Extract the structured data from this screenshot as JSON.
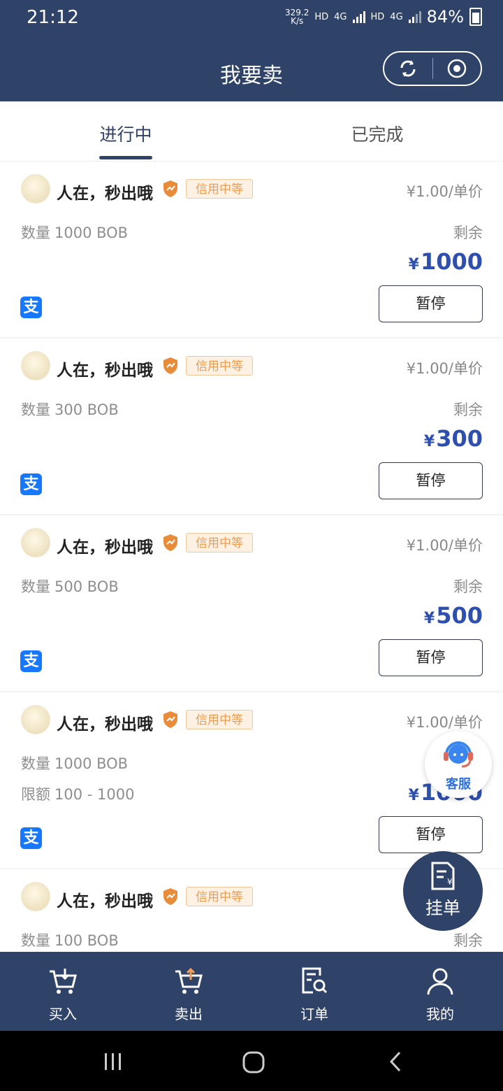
{
  "status_bar": {
    "time": "21:12",
    "net_speed_top": "329.2",
    "net_speed_bottom": "K/s",
    "hd1": "HD",
    "sig1": "4G",
    "hd2": "HD",
    "sig2": "4G",
    "battery": "84%"
  },
  "header": {
    "title": "我要卖",
    "refresh_icon": "refresh-icon",
    "record_icon": "record-icon"
  },
  "tabs": [
    {
      "label": "进行中",
      "active": true
    },
    {
      "label": "已完成",
      "active": false
    }
  ],
  "labels": {
    "qty": "数量",
    "unit_price_suffix": "/单价",
    "remain": "剩余",
    "limit": "限额",
    "pause": "暂停",
    "alipay_glyph": "支"
  },
  "listings": [
    {
      "user": "人在，秒出哦",
      "credit": "信用中等",
      "price": "¥1.00/单价",
      "qty": "1000  BOB",
      "remain_label": "剩余",
      "remain_currency": "¥",
      "remain": "1000",
      "pause": "暂停"
    },
    {
      "user": "人在，秒出哦",
      "credit": "信用中等",
      "price": "¥1.00/单价",
      "qty": "300  BOB",
      "remain_label": "剩余",
      "remain_currency": "¥",
      "remain": "300",
      "pause": "暂停"
    },
    {
      "user": "人在，秒出哦",
      "credit": "信用中等",
      "price": "¥1.00/单价",
      "qty": "500  BOB",
      "remain_label": "剩余",
      "remain_currency": "¥",
      "remain": "500",
      "pause": "暂停"
    },
    {
      "user": "人在，秒出哦",
      "credit": "信用中等",
      "price": "¥1.00/单价",
      "qty": "1000  BOB",
      "limit_label": "限额",
      "limit": "100 - 1000",
      "remain_label": "",
      "remain_currency": "¥",
      "remain": "1000",
      "pause": "暂停"
    },
    {
      "user": "人在，秒出哦",
      "credit": "信用中等",
      "price": "",
      "qty": "100  BOB",
      "remain_label": "剩余",
      "remain_currency": "",
      "remain": "",
      "pause": ""
    }
  ],
  "floating": {
    "customer_service": "客服",
    "post_order": "挂单"
  },
  "bottom_nav": [
    {
      "label": "买入",
      "icon": "cart-download-icon"
    },
    {
      "label": "卖出",
      "icon": "cart-upload-icon",
      "active": true
    },
    {
      "label": "订单",
      "icon": "order-search-icon"
    },
    {
      "label": "我的",
      "icon": "user-icon"
    }
  ],
  "colors": {
    "primary": "#2f4268",
    "accent_blue": "#2e4fad",
    "credit_orange": "#f19b4c",
    "active_tab_orange": "#f5a05a"
  }
}
